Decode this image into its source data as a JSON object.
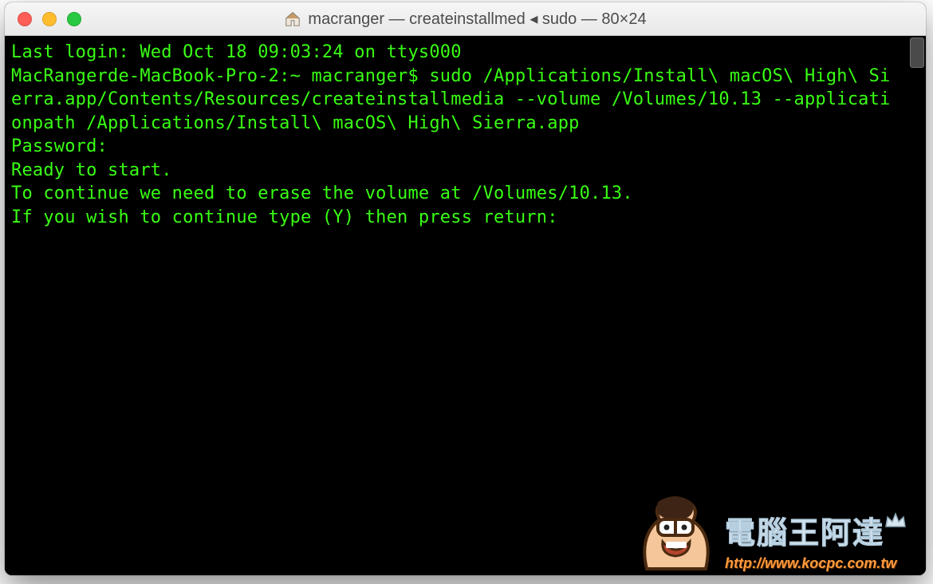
{
  "window": {
    "title": "macranger — createinstallmed ◂ sudo — 80×24"
  },
  "terminal": {
    "lines": [
      "Last login: Wed Oct 18 09:03:24 on ttys000",
      "MacRangerde-MacBook-Pro-2:~ macranger$ sudo /Applications/Install\\ macOS\\ High\\ Sierra.app/Contents/Resources/createinstallmedia --volume /Volumes/10.13 --applicationpath /Applications/Install\\ macOS\\ High\\ Sierra.app",
      "Password:",
      "Ready to start.",
      "To continue we need to erase the volume at /Volumes/10.13.",
      "If you wish to continue type (Y) then press return:"
    ]
  },
  "watermark": {
    "text_cn": "電腦王阿達",
    "url": "http://www.kocpc.com.tw"
  }
}
